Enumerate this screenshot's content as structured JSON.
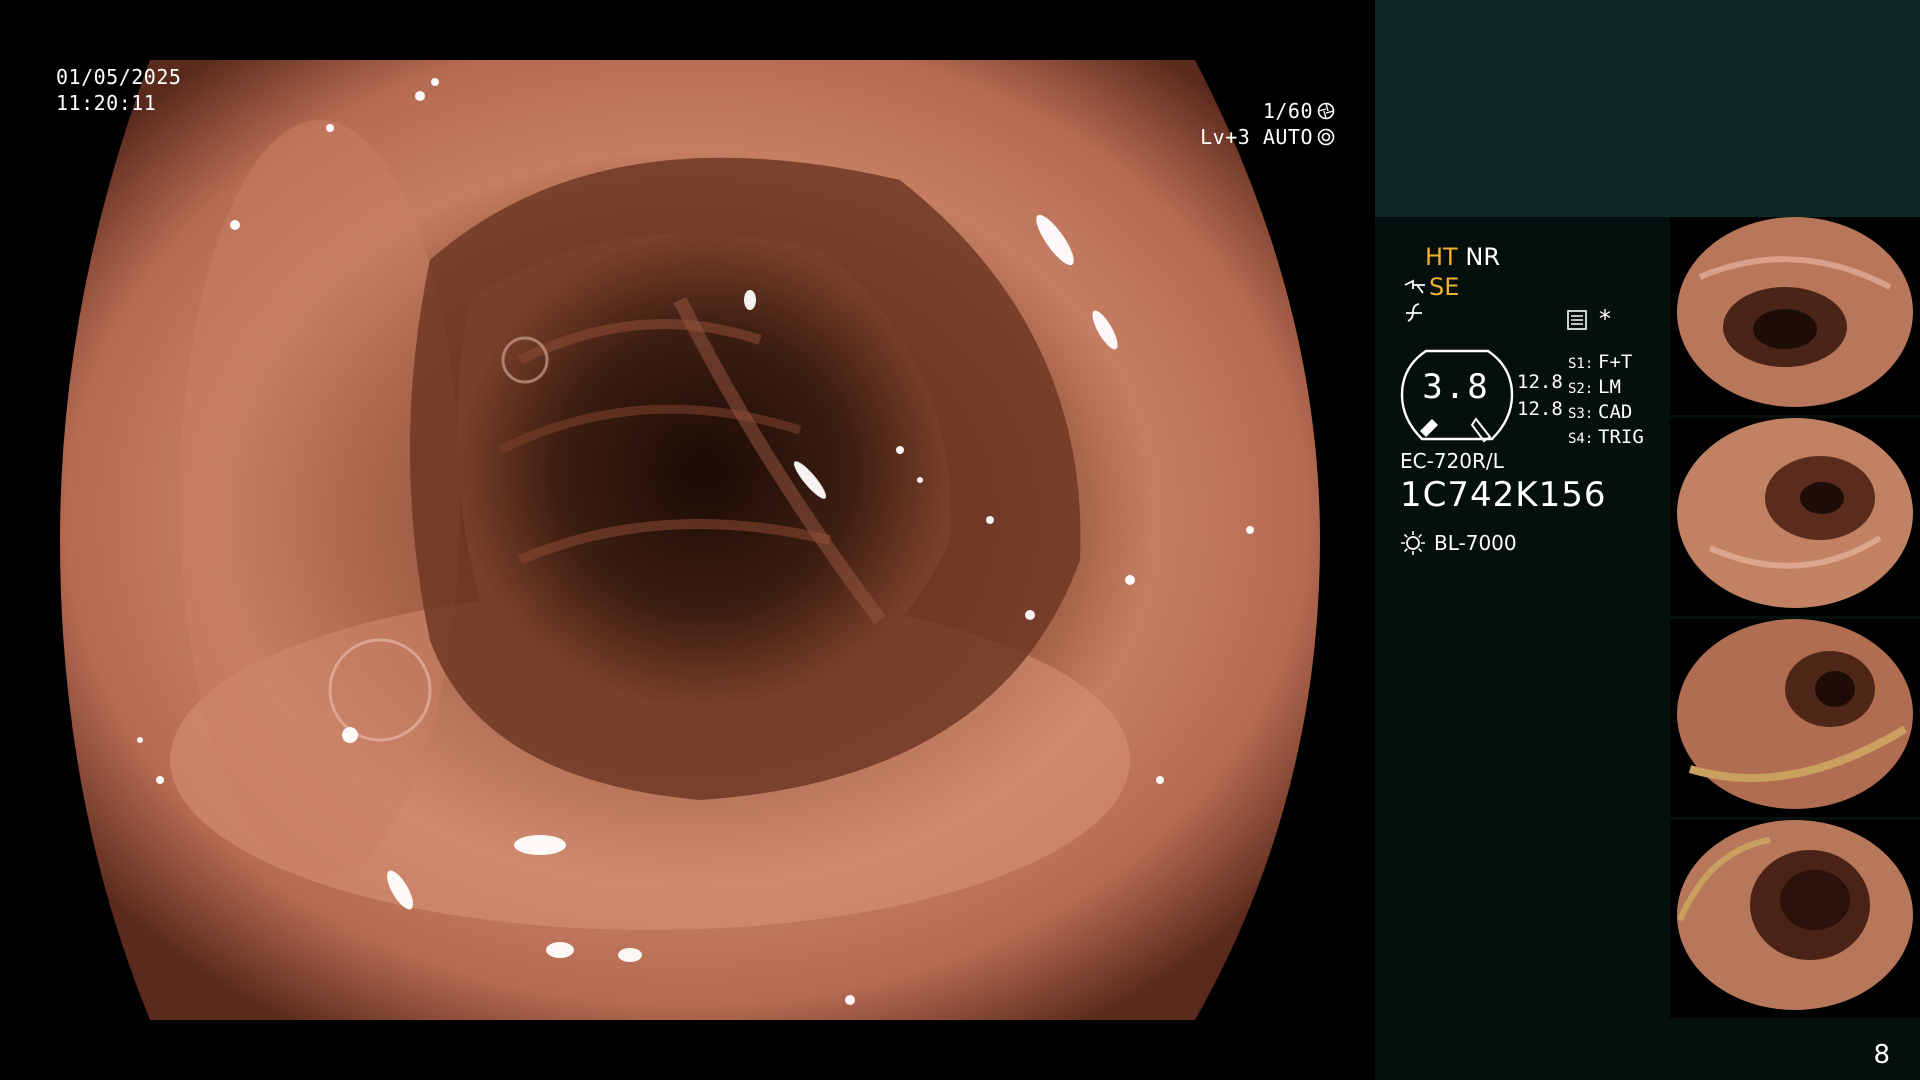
{
  "overlay": {
    "date": "01/05/2025",
    "time": "11:20:11",
    "shutter": "1/60",
    "level": "Lv+3 AUTO"
  },
  "info": {
    "mode_ht": "HT",
    "mode_nr": "NR",
    "se_label": "SE",
    "star": "*",
    "gauge_value": "3.8",
    "num_1": "12.8",
    "num_2": "12.8",
    "settings": [
      {
        "key": "S1:",
        "value": "F+T"
      },
      {
        "key": "S2:",
        "value": "LM"
      },
      {
        "key": "S3:",
        "value": "CAD"
      },
      {
        "key": "S4:",
        "value": "TRIG"
      }
    ],
    "scope_model": "EC-720R/L",
    "scope_serial": "1C742K156",
    "light_source": "BL-7000"
  },
  "page_number": "8",
  "colors": {
    "accent": "#f0b030",
    "panel_band": "#0f2825",
    "panel_bg": "#050f0d"
  }
}
